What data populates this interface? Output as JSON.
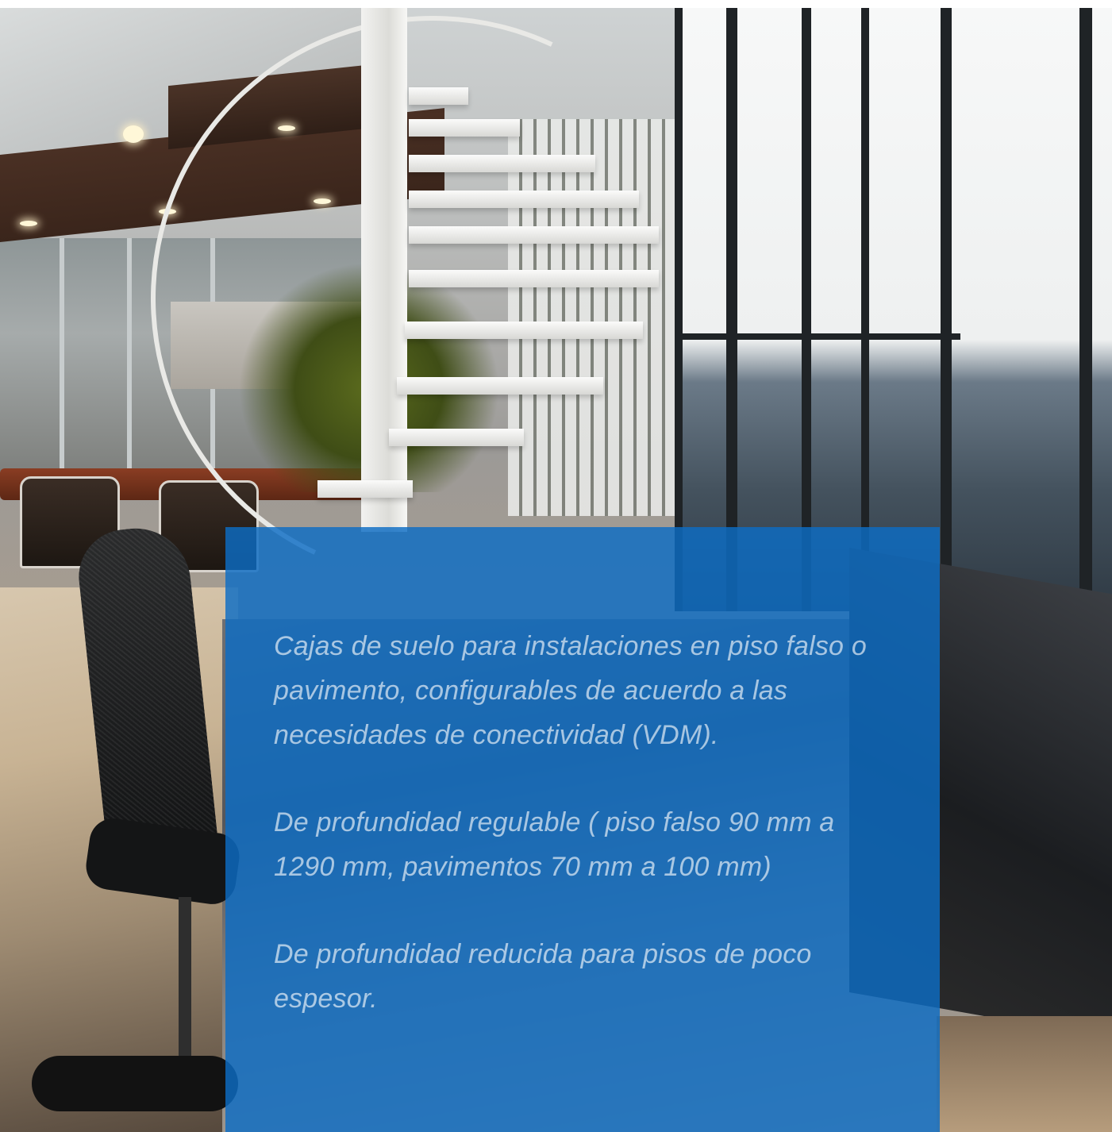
{
  "panel": {
    "paragraphs": [
      "Cajas de suelo para instalaciones en piso falso o pavimento, configurables de acuerdo  a las necesidades de conectividad (VDM).",
      "De profundidad regulable ( piso falso 90 mm a 1290 mm, pavimentos 70 mm a 100 mm)",
      "De profundidad reducida para pisos de poco espesor."
    ],
    "background_color": "#0c6cc4",
    "text_color": "#ffffff"
  },
  "background": {
    "icon": "office-interior-photo"
  }
}
